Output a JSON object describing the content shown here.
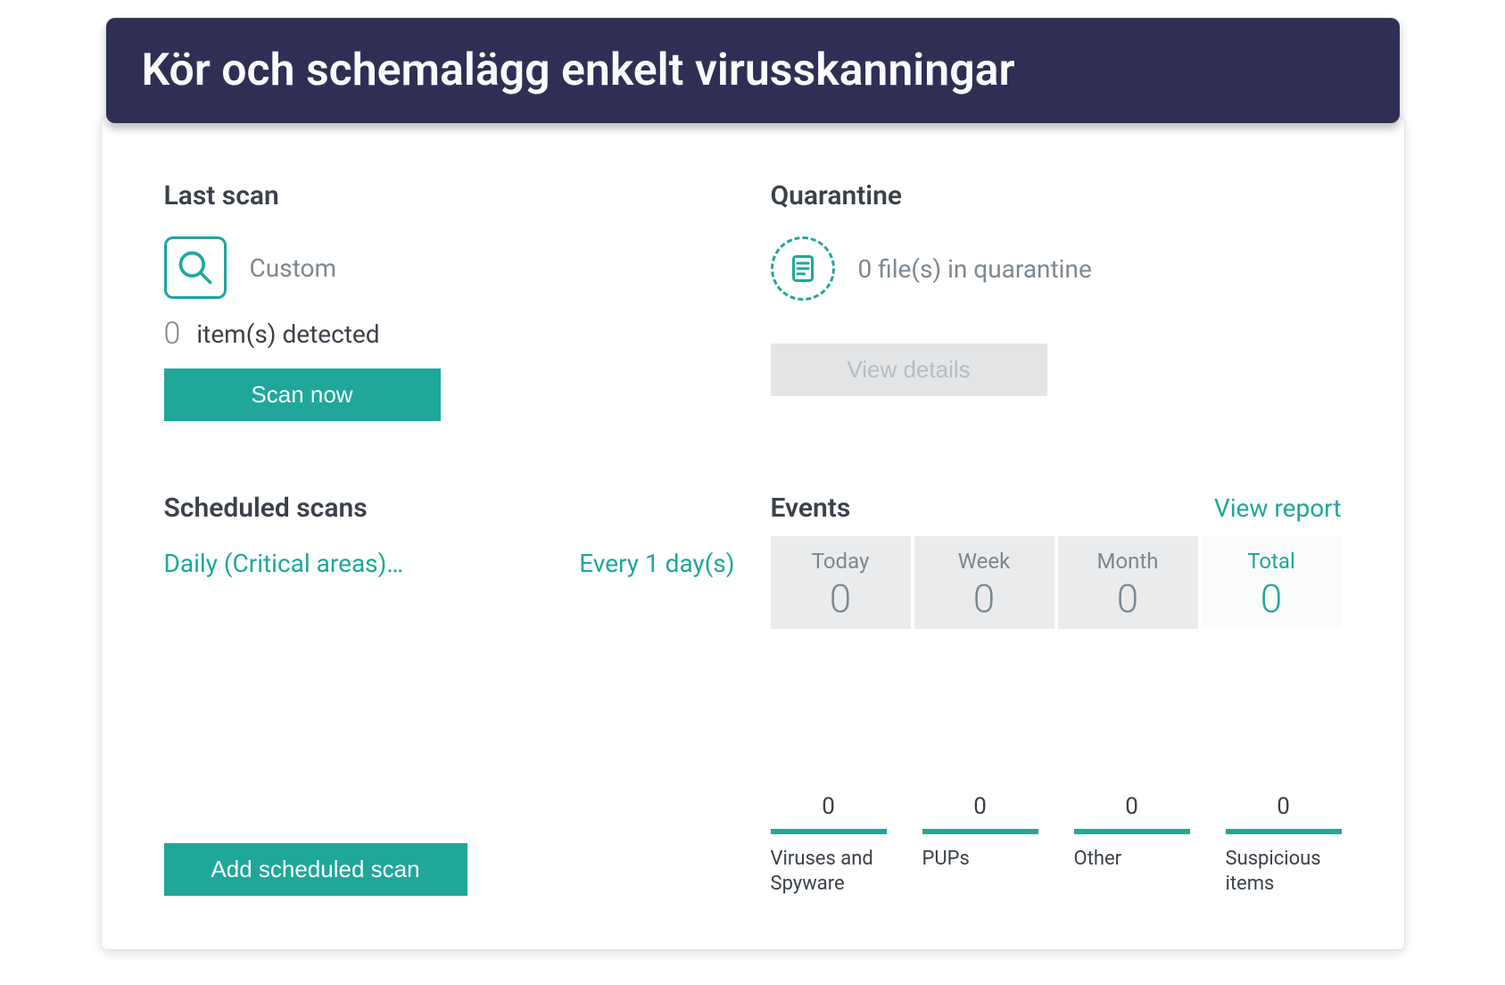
{
  "banner": {
    "title": "Kör och schemalägg enkelt virusskanningar"
  },
  "last_scan": {
    "heading": "Last scan",
    "type_label": "Custom",
    "detected_count": "0",
    "detected_suffix": "item(s) detected",
    "scan_button": "Scan now"
  },
  "quarantine": {
    "heading": "Quarantine",
    "status_text": "0 file(s) in quarantine",
    "view_button": "View details"
  },
  "scheduled": {
    "heading": "Scheduled scans",
    "item_name": "Daily (Critical areas)…",
    "item_freq": "Every 1 day(s)",
    "add_button": "Add scheduled scan"
  },
  "events": {
    "heading": "Events",
    "report_link": "View report",
    "periods": [
      {
        "label": "Today",
        "value": "0"
      },
      {
        "label": "Week",
        "value": "0"
      },
      {
        "label": "Month",
        "value": "0"
      },
      {
        "label": "Total",
        "value": "0"
      }
    ],
    "categories": [
      {
        "label": "Viruses and Spyware",
        "value": "0"
      },
      {
        "label": "PUPs",
        "value": "0"
      },
      {
        "label": "Other",
        "value": "0"
      },
      {
        "label": "Suspicious items",
        "value": "0"
      }
    ]
  },
  "colors": {
    "accent": "#1fa79a",
    "banner_bg": "#2f2f55"
  }
}
